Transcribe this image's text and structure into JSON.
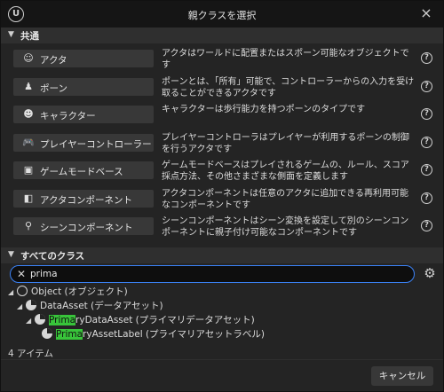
{
  "window": {
    "title": "親クラスを選択",
    "logo_text": "U",
    "close_icon": "×"
  },
  "common": {
    "header": "共通",
    "items": [
      {
        "label": "アクタ",
        "icon": "actor-icon",
        "glyph": "☺",
        "desc": "アクタはワールドに配置またはスポーン可能なオブジェクトです"
      },
      {
        "label": "ポーン",
        "icon": "pawn-icon",
        "glyph": "♟",
        "desc": "ポーンとは、「所有」可能で、コントローラーからの入力を受け取ることができるアクタです"
      },
      {
        "label": "キャラクター",
        "icon": "character-icon",
        "glyph": "☻",
        "desc": "キャラクターは歩行能力を持つポーンのタイプです"
      },
      {
        "label": "プレイヤーコントローラー",
        "icon": "gamepad-icon",
        "glyph": "🎮",
        "desc": "プレイヤーコントローラはプレイヤーが利用するポーンの制御を行うアクタです"
      },
      {
        "label": "ゲームモードベース",
        "icon": "game-mode-icon",
        "glyph": "▣",
        "desc": "ゲームモードベースはプレイされるゲームの、ルール、スコア採点方法、その他さまざまな側面を定義します"
      },
      {
        "label": "アクタコンポーネント",
        "icon": "actor-component-icon",
        "glyph": "◧",
        "desc": "アクタコンポーネントは任意のアクタに追加できる再利用可能なコンポーネントです"
      },
      {
        "label": "シーンコンポーネント",
        "icon": "scene-component-icon",
        "glyph": "⚲",
        "desc": "シーンコンポーネントはシーン変換を設定して別のシーンコンポーネントに親子付け可能なコンポーネントです"
      }
    ],
    "help_glyph": "?"
  },
  "all_classes": {
    "header": "すべてのクラス",
    "search_value": "prima",
    "clear_glyph": "✕",
    "settings_glyph": "⚙",
    "tree": [
      {
        "pre": "",
        "hl": "",
        "post": "Object (オブジェクト)",
        "icon": "object"
      },
      {
        "pre": "",
        "hl": "",
        "post": "DataAsset (データアセット)",
        "icon": "pie"
      },
      {
        "pre": "",
        "hl": "Prima",
        "post": "ryDataAsset (プライマリデータアセット)",
        "icon": "pie"
      },
      {
        "pre": "",
        "hl": "Prima",
        "post": "ryAssetLabel (プライマリアセットラベル)",
        "icon": "pie"
      }
    ],
    "item_count": "4 アイテム"
  },
  "footer": {
    "cancel_label": "キャンセル"
  }
}
